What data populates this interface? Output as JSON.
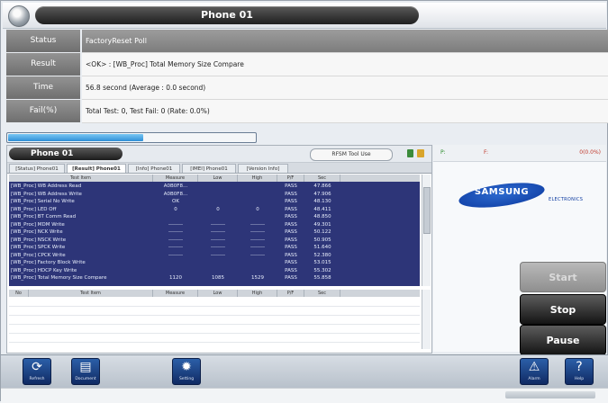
{
  "window": {
    "title": "Phone 01"
  },
  "info": [
    {
      "label": "Status",
      "value": "FactoryReset Poll"
    },
    {
      "label": "Result",
      "value": "<OK> : [WB_Proc] Total Memory Size Compare"
    },
    {
      "label": "Time",
      "value": "56.8 second (Average : 0.0 second)"
    },
    {
      "label": "Fail(%)",
      "value": "Total Test: 0, Test Fail: 0 (Rate: 0.0%)"
    }
  ],
  "progress": {
    "percent": 55
  },
  "panel": {
    "title": "Phone 01",
    "rfsm_button": "RFSM Tool Use",
    "tabs": [
      "[Status] Phone01",
      "[Result] Phone01",
      "[Info] Phone01",
      "[IMEI] Phone01",
      "[Version Info]"
    ],
    "columns": [
      "Test Item",
      "Measure",
      "Low",
      "High",
      "P/F",
      "Sec"
    ],
    "rows": [
      {
        "item": "[WB_Proc] WB Address Read",
        "measure": "A0B0F8...",
        "low": "",
        "high": "",
        "pf": "PASS",
        "sec": "47.866"
      },
      {
        "item": "[WB_Proc] WB Address Write",
        "measure": "A0B0F8...",
        "low": "",
        "high": "",
        "pf": "PASS",
        "sec": "47.906"
      },
      {
        "item": "[WB_Proc] Serial No Write",
        "measure": "OK",
        "low": "",
        "high": "",
        "pf": "PASS",
        "sec": "48.130"
      },
      {
        "item": "[WB_Proc] LED Off",
        "measure": "0",
        "low": "0",
        "high": "0",
        "pf": "PASS",
        "sec": "48.411"
      },
      {
        "item": "[WB_Proc] BT Comm Read",
        "measure": "",
        "low": "",
        "high": "",
        "pf": "PASS",
        "sec": "48.850"
      },
      {
        "item": "[WB_Proc] MDM Write",
        "measure": "--------",
        "low": "--------",
        "high": "--------",
        "pf": "PASS",
        "sec": "49.301"
      },
      {
        "item": "[WB_Proc] NCK Write",
        "measure": "--------",
        "low": "--------",
        "high": "--------",
        "pf": "PASS",
        "sec": "50.122"
      },
      {
        "item": "[WB_Proc] NSCK Write",
        "measure": "--------",
        "low": "--------",
        "high": "--------",
        "pf": "PASS",
        "sec": "50.905"
      },
      {
        "item": "[WB_Proc] SPCK Write",
        "measure": "--------",
        "low": "--------",
        "high": "--------",
        "pf": "PASS",
        "sec": "51.640"
      },
      {
        "item": "[WB_Proc] CPCK Write",
        "measure": "--------",
        "low": "--------",
        "high": "--------",
        "pf": "PASS",
        "sec": "52.380"
      },
      {
        "item": "[WB_Proc] Factory Block Write",
        "measure": "",
        "low": "",
        "high": "",
        "pf": "PASS",
        "sec": "53.015"
      },
      {
        "item": "[WB_Proc] HDCP Key Write",
        "measure": "",
        "low": "",
        "high": "",
        "pf": "PASS",
        "sec": "55.302"
      },
      {
        "item": "[WB_Proc] Total Memory Size Compare",
        "measure": "1120",
        "low": "1085",
        "high": "1529",
        "pf": "PASS",
        "sec": "55.858"
      }
    ],
    "lower_columns": [
      "No",
      "Test Item",
      "Measure",
      "Low",
      "High",
      "P/F",
      "Sec"
    ]
  },
  "stats": {
    "pass_label": "P:",
    "fail_label": "F:",
    "rate": "0(0.0%)"
  },
  "brand": {
    "name": "SAMSUNG",
    "sub": "ELECTRONICS"
  },
  "controls": {
    "start": "Start",
    "stop": "Stop",
    "pause": "Pause"
  },
  "toolbar": [
    {
      "label": "Refresh",
      "icon": "refresh-icon"
    },
    {
      "label": "Document",
      "icon": "document-icon"
    },
    {
      "label": "Setting",
      "icon": "gear-icon"
    },
    {
      "label": "Alarm",
      "icon": "warning-icon"
    },
    {
      "label": "Help",
      "icon": "help-icon"
    }
  ],
  "colors": {
    "accent": "#2e3a8c",
    "button_dark": "#1a1a1a",
    "brand_blue": "#0c3aa0"
  }
}
